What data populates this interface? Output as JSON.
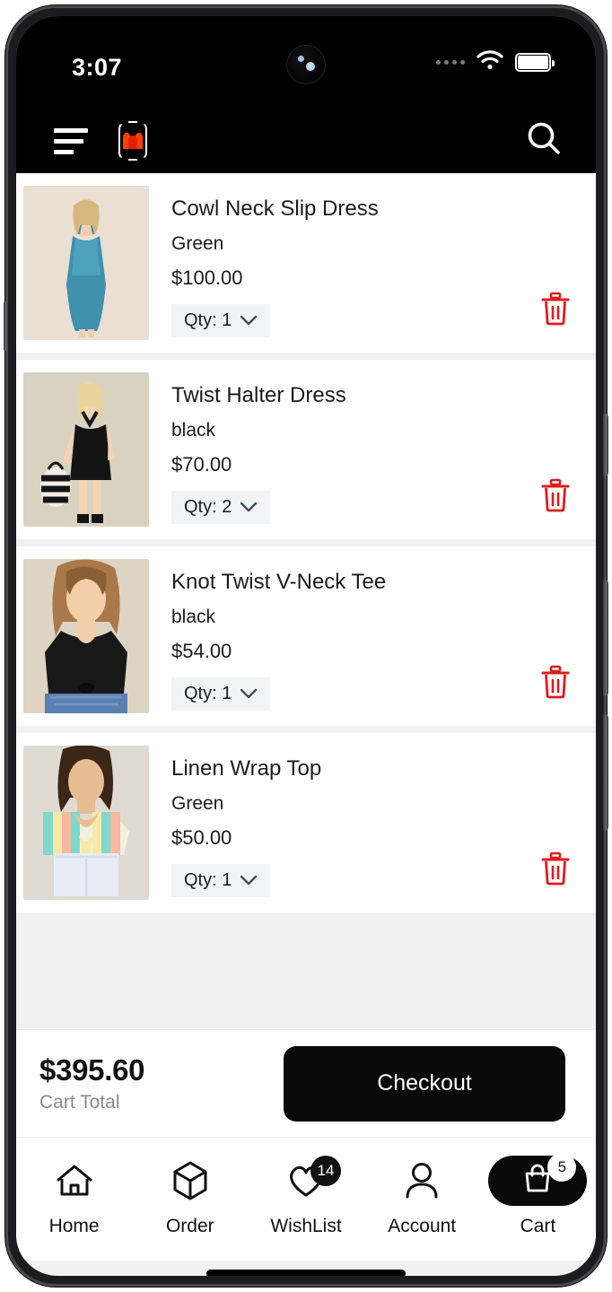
{
  "status_bar": {
    "time": "3:07",
    "signal_icon": "signal-dots-icon",
    "wifi_icon": "wifi-icon",
    "battery_icon": "battery-full-icon"
  },
  "header": {
    "menu_icon": "hamburger-menu-icon",
    "logo_icon": "brand-logo-icon",
    "search_icon": "search-icon"
  },
  "cart": {
    "items": [
      {
        "title": "Cowl Neck Slip Dress",
        "variant": "Green",
        "price": "$100.00",
        "qty_label": "Qty: 1",
        "image_alt": "blue-cowl-neck-slip-dress-thumbnail",
        "delete_icon": "trash-icon"
      },
      {
        "title": "Twist Halter Dress",
        "variant": "black",
        "price": "$70.00",
        "qty_label": "Qty: 2",
        "image_alt": "black-twist-halter-dress-thumbnail",
        "delete_icon": "trash-icon"
      },
      {
        "title": "Knot Twist V-Neck Tee",
        "variant": "black",
        "price": "$54.00",
        "qty_label": "Qty: 1",
        "image_alt": "black-knot-twist-v-neck-tee-thumbnail",
        "delete_icon": "trash-icon"
      },
      {
        "title": "Linen Wrap Top",
        "variant": "Green",
        "price": "$50.00",
        "qty_label": "Qty: 1",
        "image_alt": "striped-linen-wrap-top-thumbnail",
        "delete_icon": "trash-icon"
      }
    ]
  },
  "checkout_bar": {
    "total_amount": "$395.60",
    "total_label": "Cart Total",
    "checkout_label": "Checkout"
  },
  "bottom_nav": {
    "items": [
      {
        "label": "Home",
        "icon": "home-icon",
        "badge": ""
      },
      {
        "label": "Order",
        "icon": "box-icon",
        "badge": ""
      },
      {
        "label": "WishList",
        "icon": "heart-icon",
        "badge": "14"
      },
      {
        "label": "Account",
        "icon": "person-icon",
        "badge": ""
      },
      {
        "label": "Cart",
        "icon": "shopping-bag-icon",
        "badge": "5"
      }
    ]
  },
  "colors": {
    "accent_red": "#e01b1b",
    "brand_orange": "#ff3f00",
    "dark": "#0a0a0a",
    "page_bg": "#f1f1f2",
    "chip_bg": "#f1f3f5"
  }
}
